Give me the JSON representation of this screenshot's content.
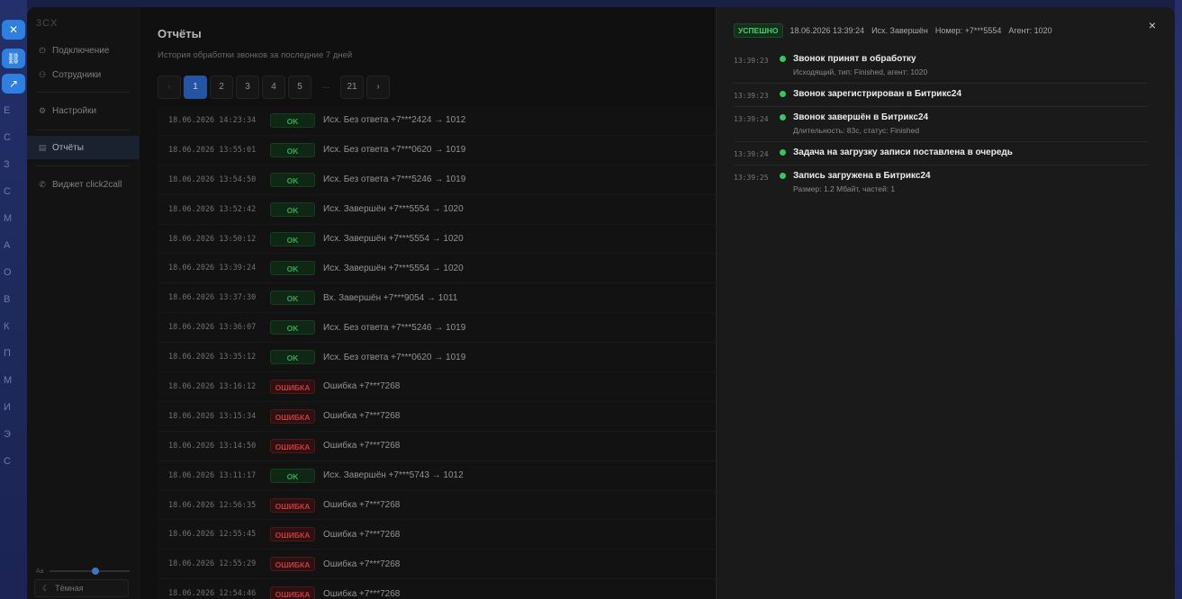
{
  "background": {
    "side_letters": [
      "E",
      "С",
      "З",
      "С",
      "М",
      "А",
      "О",
      "В",
      "К",
      "П",
      "М",
      "И",
      "Э",
      "С"
    ]
  },
  "sidebar": {
    "brand": "3CX",
    "items": [
      {
        "label": "Подключение",
        "icon": "plug-icon"
      },
      {
        "label": "Сотрудники",
        "icon": "users-icon"
      },
      {
        "label": "Настройки",
        "icon": "gear-icon"
      },
      {
        "label": "Отчёты",
        "icon": "report-icon"
      },
      {
        "label": "Виджет click2call",
        "icon": "phone-icon"
      }
    ],
    "font_label": "Aa",
    "theme_label": "Тёмная"
  },
  "main": {
    "title": "Отчёты",
    "subtitle": "История обработки звонков за последние 7 дней",
    "pager": {
      "prev": "‹",
      "pages": [
        "1",
        "2",
        "3",
        "4",
        "5"
      ],
      "ellipsis": "...",
      "last": "21",
      "next": "›",
      "current": "1"
    },
    "rows": [
      {
        "ts": "18.06.2026 14:23:34",
        "status": "OK",
        "kind": "ok",
        "desc": "Исх. Без ответа +7***2424 → 1012"
      },
      {
        "ts": "18.06.2026 13:55:01",
        "status": "OK",
        "kind": "ok",
        "desc": "Исх. Без ответа +7***0620 → 1019"
      },
      {
        "ts": "18.06.2026 13:54:50",
        "status": "OK",
        "kind": "ok",
        "desc": "Исх. Без ответа +7***5246 → 1019"
      },
      {
        "ts": "18.06.2026 13:52:42",
        "status": "OK",
        "kind": "ok",
        "desc": "Исх. Завершён +7***5554 → 1020"
      },
      {
        "ts": "18.06.2026 13:50:12",
        "status": "OK",
        "kind": "ok",
        "desc": "Исх. Завершён +7***5554 → 1020"
      },
      {
        "ts": "18.06.2026 13:39:24",
        "status": "OK",
        "kind": "ok",
        "desc": "Исх. Завершён +7***5554 → 1020"
      },
      {
        "ts": "18.06.2026 13:37:30",
        "status": "OK",
        "kind": "ok",
        "desc": "Вх. Завершён +7***9054 → 1011"
      },
      {
        "ts": "18.06.2026 13:36:07",
        "status": "OK",
        "kind": "ok",
        "desc": "Исх. Без ответа +7***5246 → 1019"
      },
      {
        "ts": "18.06.2026 13:35:12",
        "status": "OK",
        "kind": "ok",
        "desc": "Исх. Без ответа +7***0620 → 1019"
      },
      {
        "ts": "18.06.2026 13:16:12",
        "status": "ОШИБКА",
        "kind": "err",
        "desc": "Ошибка +7***7268"
      },
      {
        "ts": "18.06.2026 13:15:34",
        "status": "ОШИБКА",
        "kind": "err",
        "desc": "Ошибка +7***7268"
      },
      {
        "ts": "18.06.2026 13:14:50",
        "status": "ОШИБКА",
        "kind": "err",
        "desc": "Ошибка +7***7268"
      },
      {
        "ts": "18.06.2026 13:11:17",
        "status": "OK",
        "kind": "ok",
        "desc": "Исх. Завершён +7***5743 → 1012"
      },
      {
        "ts": "18.06.2026 12:56:35",
        "status": "ОШИБКА",
        "kind": "err",
        "desc": "Ошибка +7***7268"
      },
      {
        "ts": "18.06.2026 12:55:45",
        "status": "ОШИБКА",
        "kind": "err",
        "desc": "Ошибка +7***7268"
      },
      {
        "ts": "18.06.2026 12:55:29",
        "status": "ОШИБКА",
        "kind": "err",
        "desc": "Ошибка +7***7268"
      },
      {
        "ts": "18.06.2026 12:54:46",
        "status": "ОШИБКА",
        "kind": "err",
        "desc": "Ошибка +7***7268"
      }
    ]
  },
  "panel": {
    "status": "УСПЕШНО",
    "datetime": "18.06.2026 13:39:24",
    "call": "Исх. Завершён",
    "number": "Номер: +7***5554",
    "agent": "Агент: 1020",
    "close": "×",
    "events": [
      {
        "ts": "13:39:23",
        "title": "Звонок принят в обработку",
        "detail": "Исходящий, тип: Finished, агент: 1020"
      },
      {
        "ts": "13:39:23",
        "title": "Звонок зарегистрирован в Битрикс24",
        "detail": ""
      },
      {
        "ts": "13:39:24",
        "title": "Звонок завершён в Битрикс24",
        "detail": "Длительность: 83с, статус: Finished"
      },
      {
        "ts": "13:39:24",
        "title": "Задача на загрузку записи поставлена в очередь",
        "detail": ""
      },
      {
        "ts": "13:39:25",
        "title": "Запись загружена в Битрикс24",
        "detail": "Размер: 1.2 Мбайт, частей: 1"
      }
    ]
  },
  "colors": {
    "accent": "#2d67c8",
    "ok": "#3ecf63",
    "error": "#ef4b4b"
  }
}
